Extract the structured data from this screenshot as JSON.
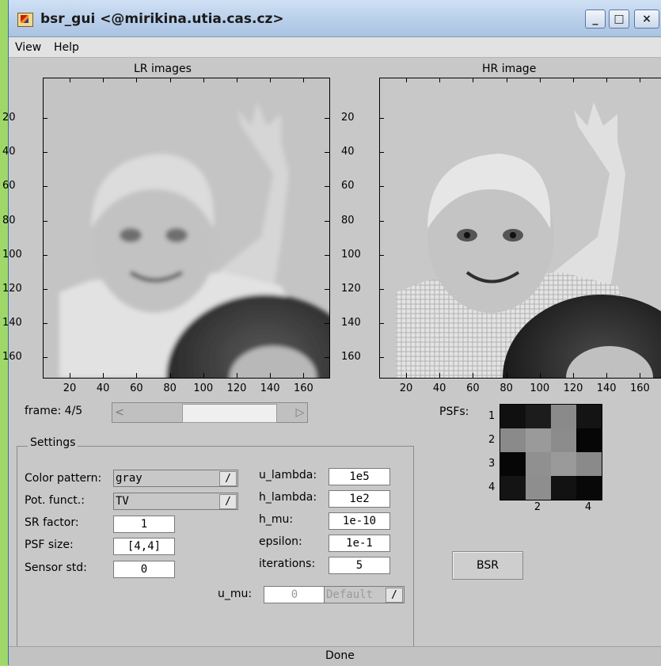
{
  "window": {
    "title": "bsr_gui <@mirikina.utia.cas.cz>",
    "controls": {
      "minimize": "_",
      "maximize": "□",
      "close": "×"
    }
  },
  "menu": {
    "items": [
      "View",
      "Help"
    ]
  },
  "lr_axes": {
    "title": "LR images",
    "yticks": [
      "20",
      "40",
      "60",
      "80",
      "100",
      "120",
      "140",
      "160"
    ],
    "xticks": [
      "20",
      "40",
      "60",
      "80",
      "100",
      "120",
      "140",
      "160"
    ]
  },
  "hr_axes": {
    "title": "HR image",
    "yticks": [
      "20",
      "40",
      "60",
      "80",
      "100",
      "120",
      "140",
      "160"
    ],
    "xticks": [
      "20",
      "40",
      "60",
      "80",
      "100",
      "120",
      "140",
      "160"
    ]
  },
  "frame": {
    "label": "frame: 4/5",
    "current": 4,
    "total": 5
  },
  "psf": {
    "label": "PSFs:",
    "yticks": [
      "1",
      "2",
      "3",
      "4"
    ],
    "xticks": [
      "2",
      "4"
    ],
    "cells": [
      "#101010",
      "#1c1c1c",
      "#8a8a8a",
      "#141414",
      "#8a8a8a",
      "#9a9a9a",
      "#8c8c8c",
      "#060606",
      "#060606",
      "#909090",
      "#9a9a9a",
      "#8a8a8a",
      "#141414",
      "#8e8e8e",
      "#121212",
      "#080808"
    ]
  },
  "settings": {
    "legend": "Settings",
    "color_pattern": {
      "label": "Color pattern:",
      "value": "gray"
    },
    "pot_funct": {
      "label": "Pot. funct.:",
      "value": "TV"
    },
    "sr_factor": {
      "label": "SR factor:",
      "value": "1"
    },
    "psf_size": {
      "label": "PSF size:",
      "value": "[4,4]"
    },
    "sensor_std": {
      "label": "Sensor std:",
      "value": "0"
    },
    "u_lambda": {
      "label": "u_lambda:",
      "value": "1e5"
    },
    "h_lambda": {
      "label": "h_lambda:",
      "value": "1e2"
    },
    "h_mu": {
      "label": "h_mu:",
      "value": "1e-10"
    },
    "epsilon": {
      "label": "epsilon:",
      "value": "1e-1"
    },
    "iterations": {
      "label": "iterations:",
      "value": "5"
    },
    "u_mu": {
      "label": "u_mu:",
      "value": "0",
      "mode": "Default"
    }
  },
  "popup_arrow": "/",
  "bsr_button": "BSR",
  "status": "Done"
}
